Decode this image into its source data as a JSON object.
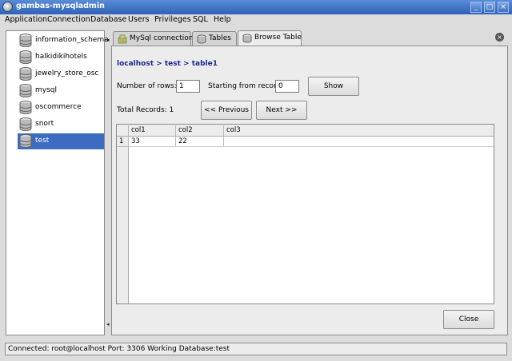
{
  "window": {
    "title": "gambas-mysqladmin"
  },
  "menu": [
    "Application",
    "Connection",
    "Database",
    "Users",
    "Privileges",
    "SQL",
    "Help"
  ],
  "databases": [
    "information_schema",
    "halkidikihotels",
    "jewelry_store_osc",
    "mysql",
    "oscommerce",
    "snort",
    "test"
  ],
  "selected_database": "test",
  "tabs": [
    "MySql connection",
    "Tables",
    "Browse Table"
  ],
  "active_tab": "Browse Table",
  "browse": {
    "breadcrumb": "localhost > test > table1",
    "rows_label": "Number of rows:",
    "rows_value": "1",
    "start_label": "Starting from record:",
    "start_value": "0",
    "show_label": "Show",
    "total_label": "Total Records: 1",
    "prev_label": "<< Previous",
    "next_label": "Next >>",
    "columns": [
      "col1",
      "col2",
      "col3"
    ],
    "rows": [
      {
        "num": "1",
        "cells": [
          "33",
          "22",
          ""
        ]
      }
    ],
    "close_label": "Close"
  },
  "status": "Connected: root@localhost Port: 3306 Working Database:test"
}
